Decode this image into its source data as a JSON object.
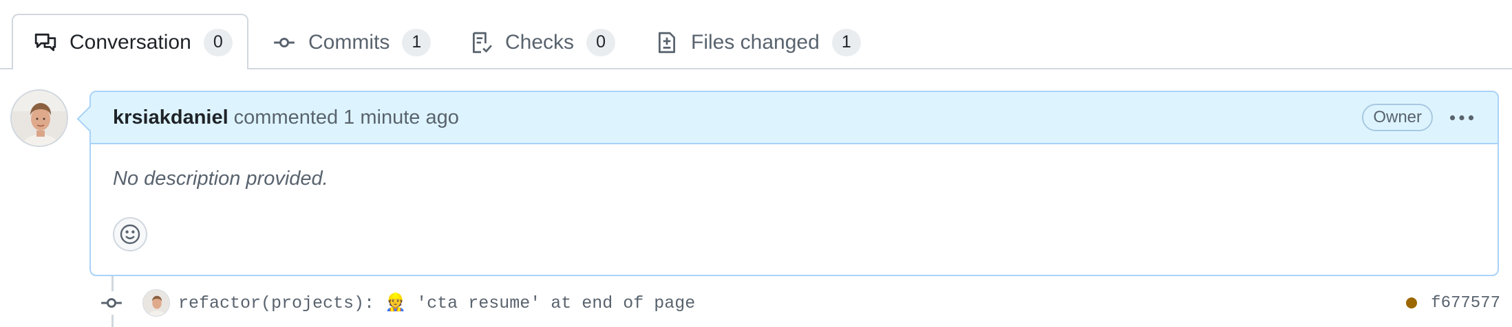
{
  "tabs": [
    {
      "label": "Conversation",
      "count": "0",
      "icon": "comment-discussion-icon",
      "selected": true
    },
    {
      "label": "Commits",
      "count": "1",
      "icon": "git-commit-icon",
      "selected": false
    },
    {
      "label": "Checks",
      "count": "0",
      "icon": "checklist-icon",
      "selected": false
    },
    {
      "label": "Files changed",
      "count": "1",
      "icon": "file-diff-icon",
      "selected": false
    }
  ],
  "comment": {
    "author": "krsiakdaniel",
    "action": "commented",
    "time": "1 minute ago",
    "badge": "Owner",
    "body": "No description provided."
  },
  "commit": {
    "message": "refactor(projects): 👷 'cta resume' at end of page",
    "sha": "f677577",
    "status_color": "#9a6700"
  },
  "colors": {
    "header_bg": "#ddf4ff",
    "header_border": "#a8d2f8",
    "border": "#d0d7de",
    "muted_text": "#59636e"
  }
}
